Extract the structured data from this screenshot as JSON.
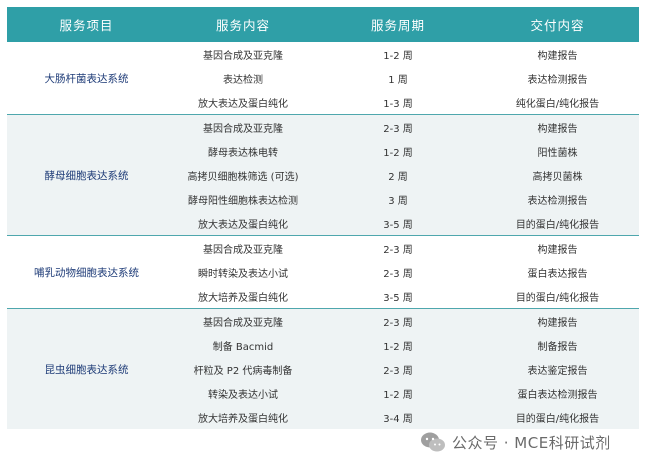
{
  "headers": [
    "服务项目",
    "服务内容",
    "服务周期",
    "交付内容"
  ],
  "groups": [
    {
      "system": "大肠杆菌表达系统",
      "rows": [
        {
          "content": "基因合成及亚克隆",
          "period": "1-2 周",
          "delivery": "构建报告"
        },
        {
          "content": "表达检测",
          "period": "1 周",
          "delivery": "表达检测报告"
        },
        {
          "content": "放大表达及蛋白纯化",
          "period": "1-3 周",
          "delivery": "纯化蛋白/纯化报告"
        }
      ]
    },
    {
      "system": "酵母细胞表达系统",
      "rows": [
        {
          "content": "基因合成及亚克隆",
          "period": "2-3 周",
          "delivery": "构建报告"
        },
        {
          "content": "酵母表达株电转",
          "period": "1-2 周",
          "delivery": "阳性菌株"
        },
        {
          "content": "高拷贝细胞株筛选 (可选)",
          "period": "2 周",
          "delivery": "高拷贝菌株"
        },
        {
          "content": "酵母阳性细胞株表达检测",
          "period": "3 周",
          "delivery": "表达检测报告"
        },
        {
          "content": "放大表达及蛋白纯化",
          "period": "3-5 周",
          "delivery": "目的蛋白/纯化报告"
        }
      ]
    },
    {
      "system": "哺乳动物细胞表达系统",
      "rows": [
        {
          "content": "基因合成及亚克隆",
          "period": "2-3 周",
          "delivery": "构建报告"
        },
        {
          "content": "瞬时转染及表达小试",
          "period": "2-3 周",
          "delivery": "蛋白表达报告"
        },
        {
          "content": "放大培养及蛋白纯化",
          "period": "3-5 周",
          "delivery": "目的蛋白/纯化报告"
        }
      ]
    },
    {
      "system": "昆虫细胞表达系统",
      "rows": [
        {
          "content": "基因合成及亚克隆",
          "period": "2-3 周",
          "delivery": "构建报告"
        },
        {
          "content": "制备 Bacmid",
          "period": "1-2 周",
          "delivery": "制备报告"
        },
        {
          "content": "杆粒及 P2 代病毒制备",
          "period": "2-3 周",
          "delivery": "表达鉴定报告"
        },
        {
          "content": "转染及表达小试",
          "period": "1-2 周",
          "delivery": "蛋白表达检测报告"
        },
        {
          "content": "放大培养及蛋白纯化",
          "period": "3-4 周",
          "delivery": "目的蛋白/纯化报告"
        }
      ]
    }
  ],
  "watermark": {
    "text": "公众号 · MCE科研试剂",
    "icon": "wechat-icon"
  },
  "colors": {
    "header_bg": "#2f9fa7",
    "alt_row_bg": "#eef3f4",
    "system_text": "#1f3c78"
  }
}
